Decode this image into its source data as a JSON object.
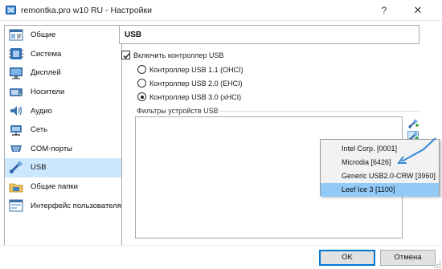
{
  "window": {
    "title": "remontka.pro w10 RU - Настройки",
    "help": "?",
    "close": "✕"
  },
  "sidebar": {
    "items": [
      {
        "label": "Общие",
        "icon": "general-icon"
      },
      {
        "label": "Система",
        "icon": "system-icon"
      },
      {
        "label": "Дисплей",
        "icon": "display-icon"
      },
      {
        "label": "Носители",
        "icon": "storage-icon"
      },
      {
        "label": "Аудио",
        "icon": "audio-icon"
      },
      {
        "label": "Сеть",
        "icon": "network-icon"
      },
      {
        "label": "COM-порты",
        "icon": "serial-ports-icon"
      },
      {
        "label": "USB",
        "icon": "usb-icon",
        "selected": true
      },
      {
        "label": "Общие папки",
        "icon": "shared-folders-icon"
      },
      {
        "label": "Интерфейс пользователя",
        "icon": "user-interface-icon"
      }
    ]
  },
  "usb": {
    "header": "USB",
    "enable_label": "Включить контроллер USB",
    "enable_checked": true,
    "controllers": [
      {
        "label": "Контроллер USB 1.1 (OHCI)",
        "selected": false
      },
      {
        "label": "Контроллер USB 2.0 (EHCI)",
        "selected": false
      },
      {
        "label": "Контроллер USB 3.0 (xHCI)",
        "selected": true
      }
    ],
    "filters_label": "Фильтры устройств USB"
  },
  "device_menu": {
    "items": [
      {
        "label": "Intel Corp. [0001]",
        "active": false
      },
      {
        "label": "Microdia  [6426]",
        "active": false
      },
      {
        "label": "Generic USB2.0-CRW [3960]",
        "active": false
      },
      {
        "label": "Leef Ice 3 [1100]",
        "active": true
      }
    ]
  },
  "footer": {
    "ok_label": "OK",
    "cancel_label": "Отмена"
  },
  "colors": {
    "selection": "#cce8ff",
    "menu_highlight": "#91c9f7",
    "accent": "#0078d7",
    "arrow": "#3a8ad6"
  }
}
